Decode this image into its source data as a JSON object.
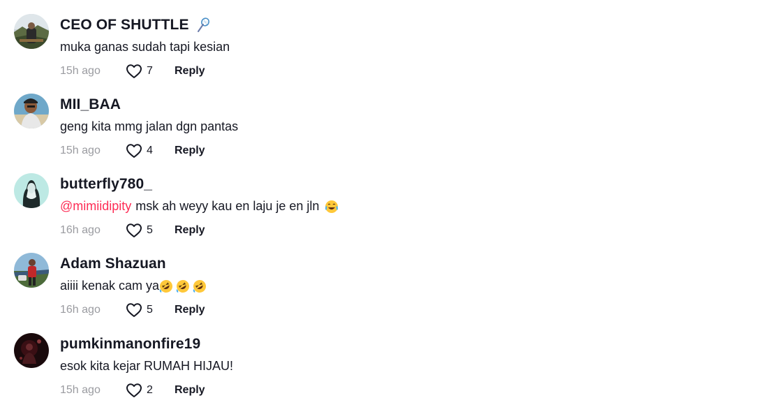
{
  "comments": [
    {
      "username": "CEO OF SHUTTLE",
      "username_icon": "badminton-racket-icon",
      "mention": "",
      "text": "muka ganas sudah tapi kesian",
      "emojis": [],
      "time": "15h ago",
      "likes": "7",
      "reply_label": "Reply"
    },
    {
      "username": "MII_BAA",
      "username_icon": "",
      "mention": "",
      "text": "geng kita mmg jalan dgn pantas",
      "emojis": [],
      "time": "15h ago",
      "likes": "4",
      "reply_label": "Reply"
    },
    {
      "username": "butterfly780_",
      "username_icon": "",
      "mention": "@mimiidipity",
      "text": "msk ah weyy kau en laju je en jln",
      "emojis": [
        "tears-of-joy-emoji"
      ],
      "time": "16h ago",
      "likes": "5",
      "reply_label": "Reply"
    },
    {
      "username": "Adam Shazuan",
      "username_icon": "",
      "mention": "",
      "text": "aiiii kenak cam ya",
      "emojis": [
        "rofl-emoji",
        "rofl-emoji",
        "rofl-emoji"
      ],
      "time": "16h ago",
      "likes": "5",
      "reply_label": "Reply"
    },
    {
      "username": "pumkinmanonfire19",
      "username_icon": "",
      "mention": "",
      "text": "esok kita kejar RUMAH HIJAU!",
      "emojis": [],
      "time": "15h ago",
      "likes": "2",
      "reply_label": "Reply"
    }
  ],
  "colors": {
    "mention": "#fe2c55",
    "meta_gray": "#9a9ba0",
    "text": "#161823"
  }
}
